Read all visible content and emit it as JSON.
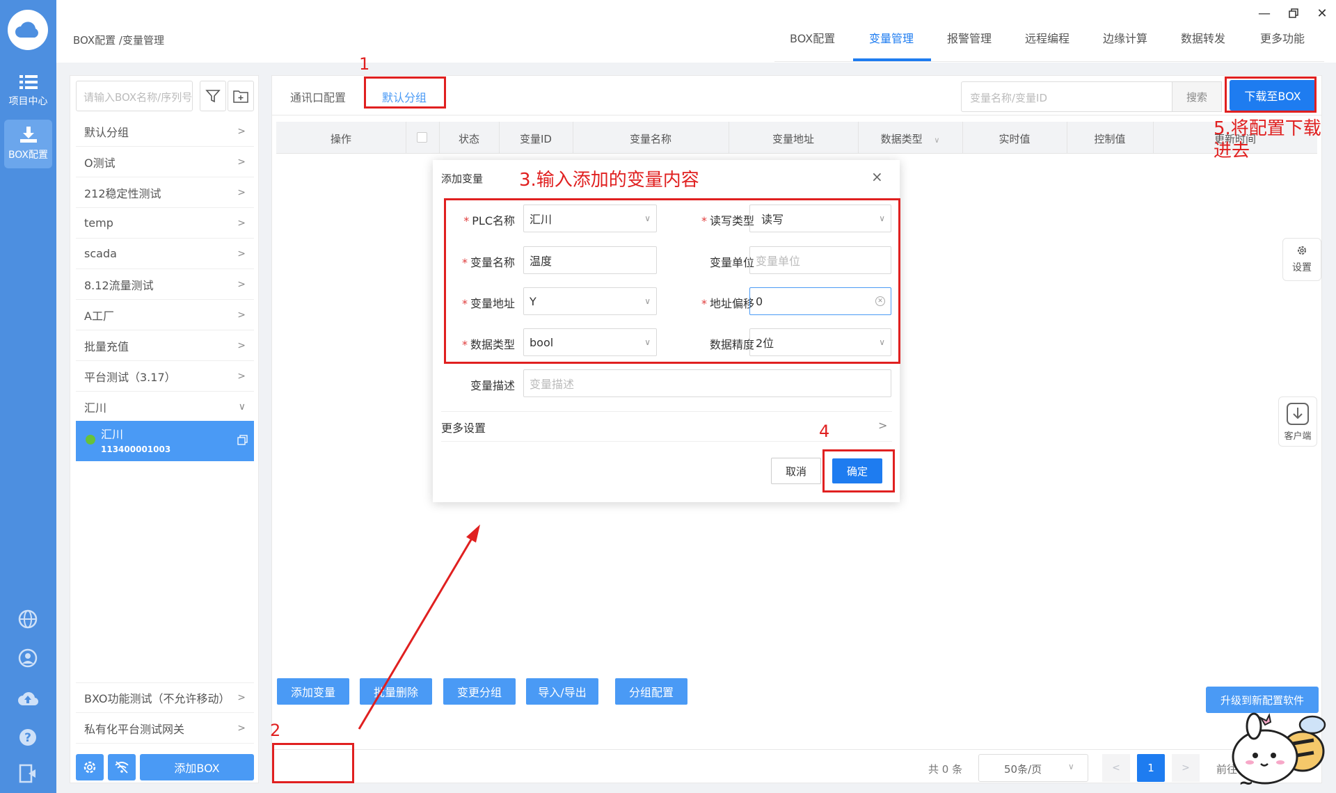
{
  "rail": {
    "items": [
      {
        "label": "项目中心",
        "icon": "list-icon"
      },
      {
        "label": "BOX配置",
        "icon": "download-icon"
      }
    ]
  },
  "topbar": {
    "breadcrumb": "BOX配置 /变量管理",
    "tabs": [
      "BOX配置",
      "变量管理",
      "报警管理",
      "远程编程",
      "边缘计算",
      "数据转发",
      "更多功能"
    ],
    "active_tab": "变量管理"
  },
  "sidebar": {
    "search_placeholder": "请输入BOX名称/序列号",
    "groups": [
      "默认分组",
      "O测试",
      "212稳定性测试",
      "temp",
      "scada",
      "8.12流量测试",
      "A工厂",
      "批量充值",
      "平台测试（3.17）",
      "汇川"
    ],
    "active_device": {
      "name": "汇川",
      "serial": "113400001003"
    },
    "bottom_groups": [
      "BXO功能测试（不允许移动）",
      "私有化平台测试网关"
    ],
    "add_box_label": "添加BOX"
  },
  "main": {
    "subtabs": [
      "通讯口配置",
      "默认分组"
    ],
    "active_subtab": "默认分组",
    "search_placeholder": "变量名称/变量ID",
    "search_button": "搜索",
    "download_button": "下载至BOX",
    "columns": [
      "操作",
      "状态",
      "变量ID",
      "变量名称",
      "变量地址",
      "数据类型",
      "实时值",
      "控制值",
      "更新时间"
    ],
    "actions": [
      "添加变量",
      "批量删除",
      "变更分组",
      "导入/导出",
      "分组配置"
    ],
    "pager": {
      "total": "共 0 条",
      "page_size": "50条/页",
      "current_page": "1",
      "goto": "前往"
    }
  },
  "dialog": {
    "title": "添加变量",
    "fields": {
      "plc_name": {
        "label": "PLC名称",
        "value": "汇川"
      },
      "rw_type": {
        "label": "读写类型",
        "value": "读写"
      },
      "var_name": {
        "label": "变量名称",
        "value": "温度"
      },
      "var_unit": {
        "label": "变量单位",
        "placeholder": "变量单位"
      },
      "var_addr": {
        "label": "变量地址",
        "value": "Y"
      },
      "addr_offset": {
        "label": "地址偏移",
        "value": "0"
      },
      "data_type": {
        "label": "数据类型",
        "value": "bool"
      },
      "precision": {
        "label": "数据精度",
        "value": "2位"
      },
      "desc": {
        "label": "变量描述",
        "placeholder": "变量描述"
      }
    },
    "more_settings": "更多设置",
    "cancel": "取消",
    "confirm": "确定"
  },
  "floating": {
    "settings": "设置",
    "client": "客户端",
    "upgrade": "升级到新配置软件"
  },
  "annotations": {
    "step1": "1",
    "step2": "2",
    "step3": "3.输入添加的变量内容",
    "step4": "4",
    "step5_line1": "5.将配置下载",
    "step5_line2": "进去"
  },
  "colors": {
    "primary": "#1e7cf0",
    "rail": "#4d8fe0",
    "annotation": "#e02020"
  }
}
